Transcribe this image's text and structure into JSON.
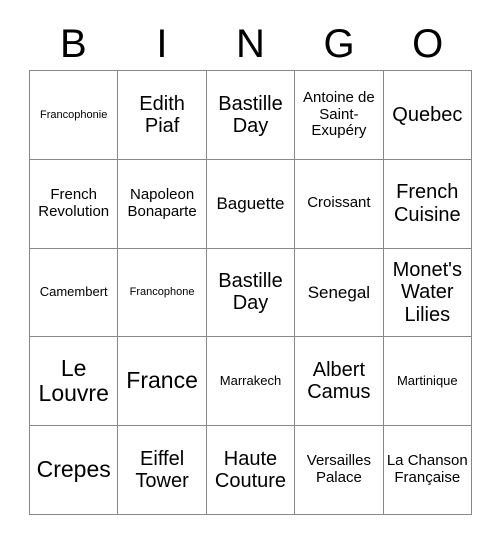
{
  "card": {
    "type": "bingo-card",
    "theme_text": "BINGO",
    "columns": 5,
    "rows": 5,
    "border_color": "#888888",
    "text_color": "#000000",
    "background_color": "#ffffff"
  },
  "header": {
    "letters": [
      {
        "label": "B"
      },
      {
        "label": "I"
      },
      {
        "label": "N"
      },
      {
        "label": "G"
      },
      {
        "label": "O"
      }
    ]
  },
  "grid": {
    "rows": [
      {
        "cells": [
          {
            "label": "Francophonie",
            "size": "fs-xs"
          },
          {
            "label": "Edith Piaf",
            "size": "fs-xl"
          },
          {
            "label": "Bastille Day",
            "size": "fs-xl"
          },
          {
            "label": "Antoine de Saint-Exupéry",
            "size": "fs-m"
          },
          {
            "label": "Quebec",
            "size": "fs-xl"
          }
        ]
      },
      {
        "cells": [
          {
            "label": "French Revolution",
            "size": "fs-m"
          },
          {
            "label": "Napoleon Bonaparte",
            "size": "fs-m"
          },
          {
            "label": "Baguette",
            "size": "fs-l"
          },
          {
            "label": "Croissant",
            "size": "fs-m"
          },
          {
            "label": "French Cuisine",
            "size": "fs-xl"
          }
        ]
      },
      {
        "cells": [
          {
            "label": "Camembert",
            "size": "fs-s"
          },
          {
            "label": "Francophone",
            "size": "fs-xs"
          },
          {
            "label": "Bastille Day",
            "size": "fs-xl"
          },
          {
            "label": "Senegal",
            "size": "fs-l"
          },
          {
            "label": "Monet's Water Lilies",
            "size": "fs-xl"
          }
        ]
      },
      {
        "cells": [
          {
            "label": "Le Louvre",
            "size": "fs-xxl"
          },
          {
            "label": "France",
            "size": "fs-xxl"
          },
          {
            "label": "Marrakech",
            "size": "fs-s"
          },
          {
            "label": "Albert Camus",
            "size": "fs-xl"
          },
          {
            "label": "Martinique",
            "size": "fs-s"
          }
        ]
      },
      {
        "cells": [
          {
            "label": "Crepes",
            "size": "fs-xxl"
          },
          {
            "label": "Eiffel Tower",
            "size": "fs-xl"
          },
          {
            "label": "Haute Couture",
            "size": "fs-xl"
          },
          {
            "label": "Versailles Palace",
            "size": "fs-m"
          },
          {
            "label": "La Chanson Française",
            "size": "fs-m"
          }
        ]
      }
    ]
  }
}
